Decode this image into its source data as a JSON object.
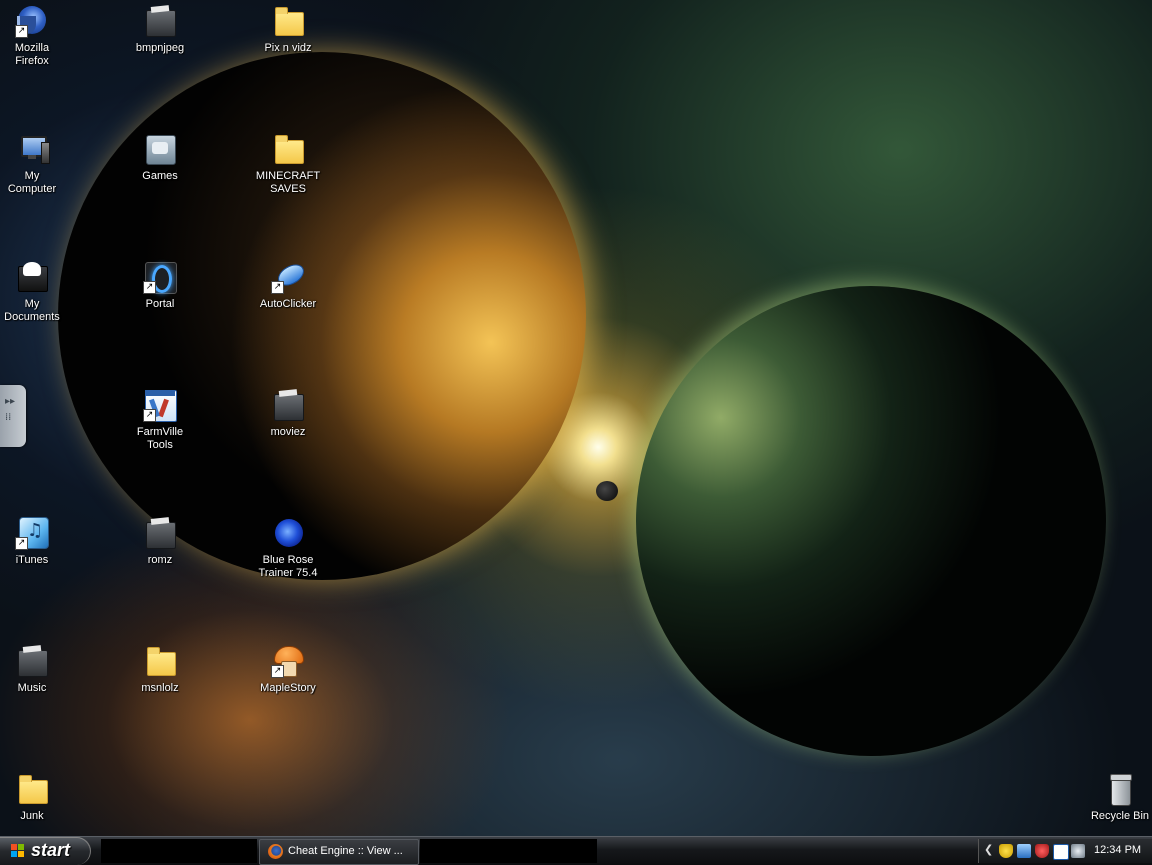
{
  "desktop": {
    "icons": [
      {
        "id": "firefox",
        "label": "Mozilla\nFirefox",
        "icon": "firefox-icon",
        "shortcut": true
      },
      {
        "id": "bmpnjpeg",
        "label": "bmpnjpeg",
        "icon": "dark-folder-icon",
        "shortcut": false
      },
      {
        "id": "pixnvidz",
        "label": "Pix n vidz",
        "icon": "folder-icon",
        "shortcut": false
      },
      {
        "id": "mycomputer",
        "label": "My\nComputer",
        "icon": "computer-icon",
        "shortcut": false
      },
      {
        "id": "games",
        "label": "Games",
        "icon": "games-folder-icon",
        "shortcut": false
      },
      {
        "id": "minecraftsaves",
        "label": "MINECRAFT\nSAVES",
        "icon": "folder-icon",
        "shortcut": false
      },
      {
        "id": "mydocuments",
        "label": "My\nDocuments",
        "icon": "documents-icon",
        "shortcut": false
      },
      {
        "id": "portal",
        "label": "Portal",
        "icon": "portal-icon",
        "shortcut": true
      },
      {
        "id": "autoclicker",
        "label": "AutoClicker",
        "icon": "mouse-icon",
        "shortcut": true
      },
      {
        "id": "farmvilletools",
        "label": "FarmVille\nTools",
        "icon": "farmville-tools-icon",
        "shortcut": true
      },
      {
        "id": "moviez",
        "label": "moviez",
        "icon": "dark-folder-icon",
        "shortcut": false
      },
      {
        "id": "itunes",
        "label": "iTunes",
        "icon": "itunes-icon",
        "shortcut": true
      },
      {
        "id": "romz",
        "label": "romz",
        "icon": "dark-folder-icon",
        "shortcut": false
      },
      {
        "id": "bluerose",
        "label": "Blue Rose\nTrainer 75.4",
        "icon": "blue-rose-icon",
        "shortcut": false
      },
      {
        "id": "music",
        "label": "Music",
        "icon": "dark-folder-icon",
        "shortcut": false
      },
      {
        "id": "msnlolz",
        "label": "msnlolz",
        "icon": "folder-icon",
        "shortcut": false
      },
      {
        "id": "maplestory",
        "label": "MapleStory",
        "icon": "maplestory-icon",
        "shortcut": true
      },
      {
        "id": "junk",
        "label": "Junk",
        "icon": "folder-icon",
        "shortcut": false
      },
      {
        "id": "recyclebin",
        "label": "Recycle Bin",
        "icon": "recycle-bin-icon",
        "shortcut": false
      }
    ]
  },
  "taskbar": {
    "start_label": "start",
    "tasks": [
      {
        "label": "Cheat Engine :: View ...",
        "icon": "firefox-icon"
      }
    ],
    "tray": {
      "icons": [
        "chevron-left-icon",
        "security-shield-icon",
        "network-icon",
        "antivirus-icon",
        "connection-icon",
        "blocked-icon"
      ],
      "clock": "12:34 PM"
    }
  }
}
